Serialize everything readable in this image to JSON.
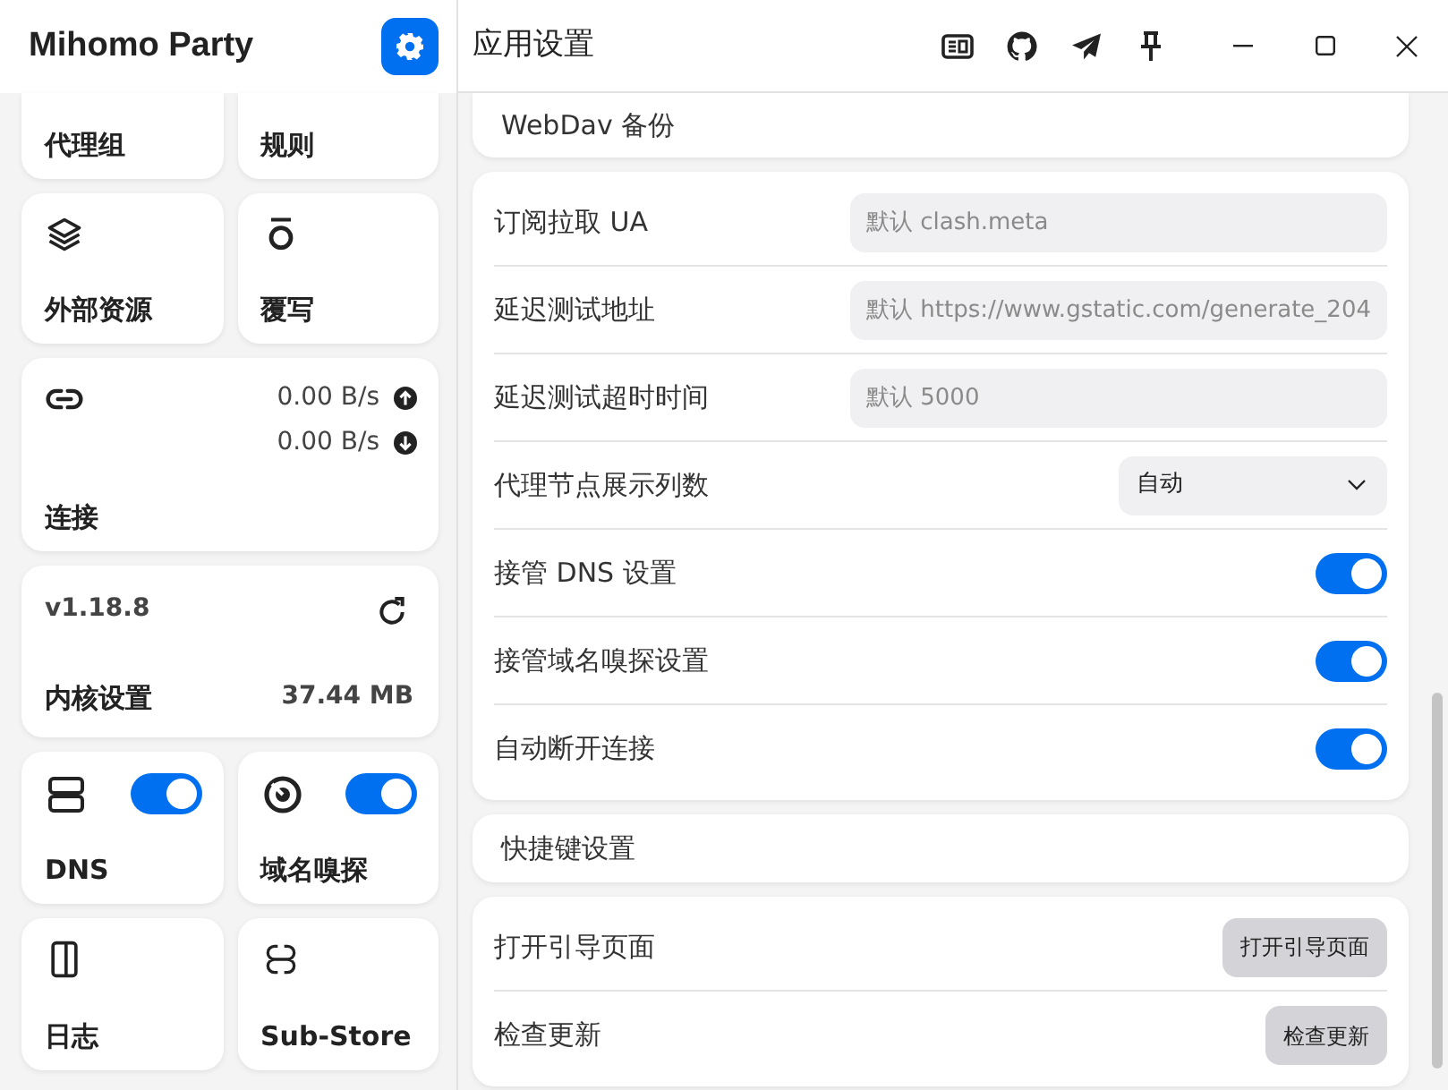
{
  "app": {
    "title": "Mihomo Party"
  },
  "sidebar": {
    "cards": [
      {
        "kind": "nav",
        "label": "代理组"
      },
      {
        "kind": "nav",
        "label": "规则"
      },
      {
        "kind": "nav",
        "label": "外部资源"
      },
      {
        "kind": "nav",
        "label": "覆写"
      },
      {
        "kind": "connection",
        "label": "连接",
        "upload": "0.00 B/s",
        "download": "0.00 B/s"
      },
      {
        "kind": "core",
        "version": "v1.18.8",
        "label": "内核设置",
        "memory": "37.44 MB"
      },
      {
        "kind": "toggle",
        "label": "DNS",
        "on": true
      },
      {
        "kind": "toggle",
        "label": "域名嗅探",
        "on": true
      },
      {
        "kind": "nav",
        "label": "日志"
      },
      {
        "kind": "nav",
        "label": "Sub-Store"
      }
    ]
  },
  "window": {
    "title": "应用设置"
  },
  "sections": [
    {
      "kind": "header",
      "title": "WebDav 备份"
    },
    {
      "kind": "group",
      "rows": [
        {
          "kind": "input",
          "label": "订阅拉取 UA",
          "placeholder": "默认 clash.meta"
        },
        {
          "kind": "input",
          "label": "延迟测试地址",
          "placeholder": "默认 https://www.gstatic.com/generate_204"
        },
        {
          "kind": "input",
          "label": "延迟测试超时时间",
          "placeholder": "默认 5000"
        },
        {
          "kind": "select",
          "label": "代理节点展示列数",
          "value": "自动"
        },
        {
          "kind": "switch",
          "label": "接管 DNS 设置",
          "on": true
        },
        {
          "kind": "switch",
          "label": "接管域名嗅探设置",
          "on": true
        },
        {
          "kind": "switch",
          "label": "自动断开连接",
          "on": true
        }
      ]
    },
    {
      "kind": "header",
      "title": "快捷键设置"
    },
    {
      "kind": "group",
      "rows": [
        {
          "kind": "button",
          "label": "打开引导页面",
          "button": "打开引导页面"
        },
        {
          "kind": "button",
          "label": "检查更新",
          "button": "检查更新"
        }
      ]
    }
  ]
}
